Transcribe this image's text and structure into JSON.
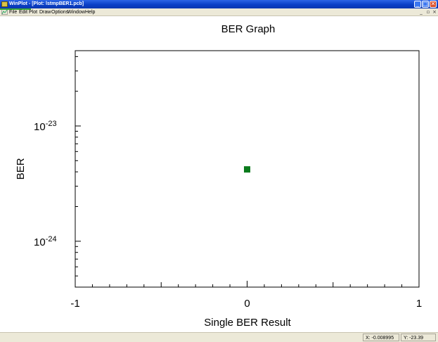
{
  "window": {
    "title": "WinPlot - [Plot: lstmpBER1.pcb]",
    "minimize_glyph": "_",
    "maximize_glyph": "□",
    "close_glyph": "✕"
  },
  "menu": {
    "items": [
      "File",
      "Edit",
      "Plot",
      "Draw",
      "Options",
      "Window",
      "Help"
    ],
    "mdi_min": "_",
    "mdi_restore": "▫",
    "mdi_close": "×"
  },
  "chart_data": {
    "type": "scatter",
    "title": "BER Graph",
    "xlabel": "Single BER Result",
    "ylabel": "BER",
    "xlim": [
      -1,
      1
    ],
    "ylim": [
      4e-25,
      4.5e-23
    ],
    "yscale": "log",
    "x_tick_labels": [
      "-1",
      "0",
      "1"
    ],
    "x_ticks": [
      -1,
      0,
      1
    ],
    "y_tick_labels": [
      {
        "base": "10",
        "exp": "-23",
        "value": 1e-23
      },
      {
        "base": "10",
        "exp": "-24",
        "value": 1e-24
      }
    ],
    "grid": false,
    "marker_color": "#0a7a1c",
    "series": [
      {
        "x": [
          0
        ],
        "y": [
          4.2e-24
        ]
      }
    ]
  },
  "status": {
    "x_readout": "X: -0.008995",
    "y_readout": "Y: -23.39"
  }
}
